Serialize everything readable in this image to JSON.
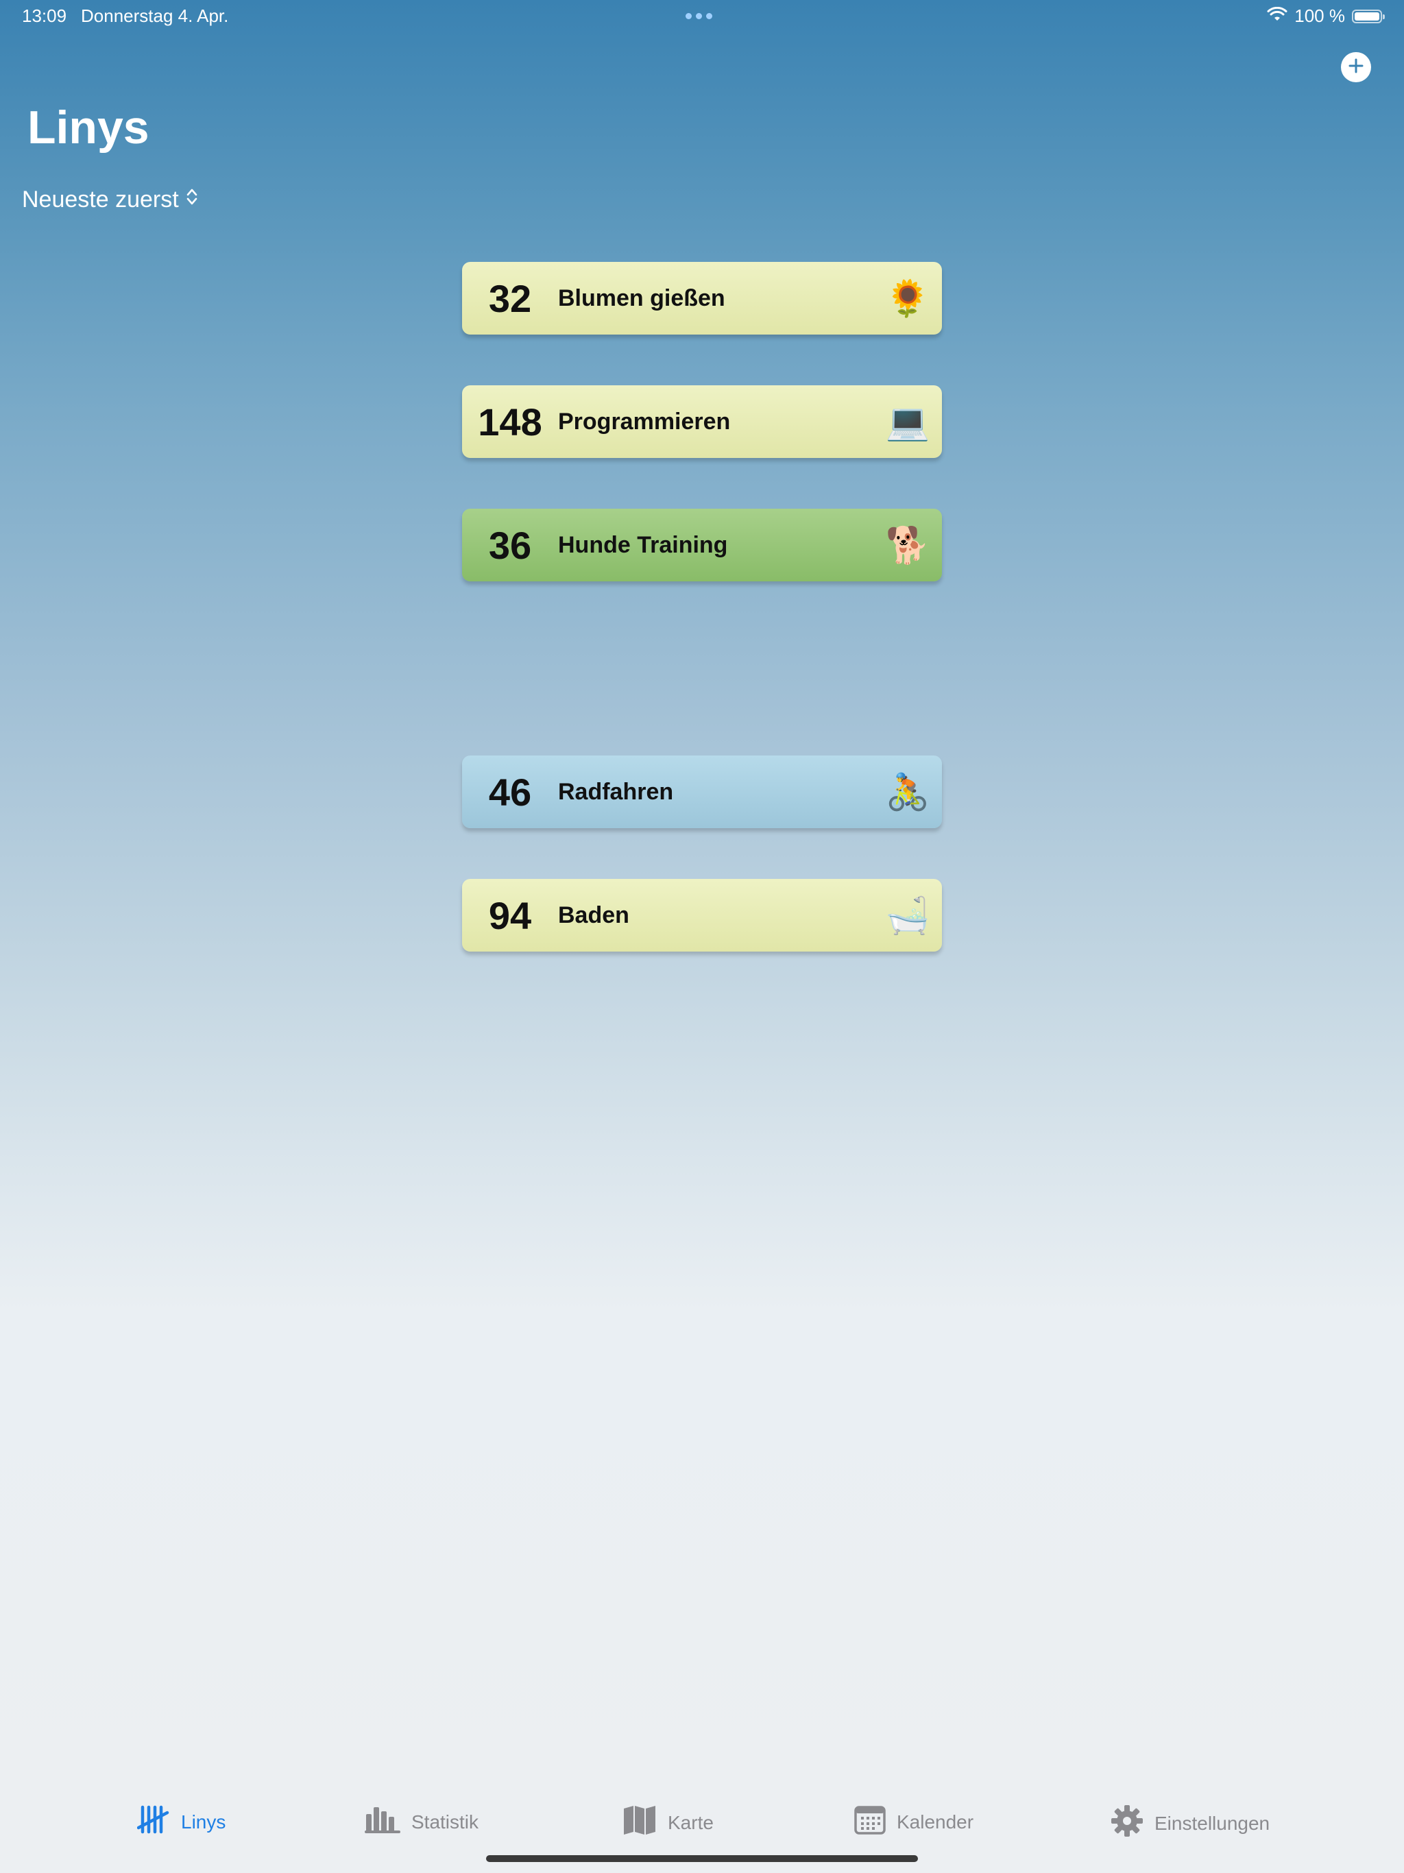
{
  "status": {
    "time": "13:09",
    "date": "Donnerstag 4. Apr.",
    "battery": "100 %"
  },
  "header": {
    "title": "Linys",
    "sort_label": "Neueste zuerst"
  },
  "items": [
    {
      "count": "32",
      "name": "Blumen gießen",
      "emoji": "🌻",
      "color": "#e8ecb8"
    },
    {
      "count": "148",
      "name": "Programmieren",
      "emoji": "💻",
      "color": "#e8ecb8"
    },
    {
      "count": "36",
      "name": "Hunde Training",
      "emoji": "🐕",
      "color": "#98c678"
    },
    {
      "count": "46",
      "name": "Radfahren",
      "emoji": "🚴",
      "color": "#a9d0e2"
    },
    {
      "count": "94",
      "name": "Baden",
      "emoji": "🛁",
      "color": "#e8ecb8"
    }
  ],
  "tabs": [
    {
      "label": "Linys",
      "icon": "tally-icon",
      "active": true
    },
    {
      "label": "Statistik",
      "icon": "bar-chart-icon",
      "active": false
    },
    {
      "label": "Karte",
      "icon": "map-icon",
      "active": false
    },
    {
      "label": "Kalender",
      "icon": "calendar-icon",
      "active": false
    },
    {
      "label": "Einstellungen",
      "icon": "gear-icon",
      "active": false
    }
  ],
  "colors": {
    "accent": "#1f7fe4",
    "inactive": "#8a8a8e"
  }
}
